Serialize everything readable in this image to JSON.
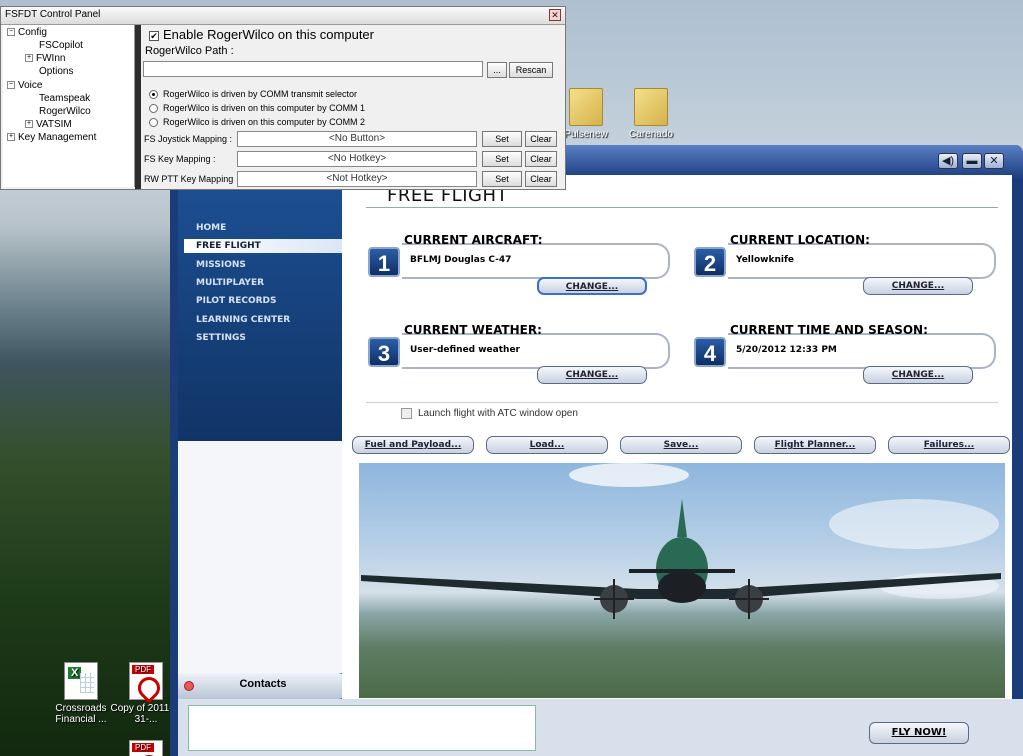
{
  "desktop": {
    "icons": [
      {
        "label": "Pulsenew",
        "type": "folder"
      },
      {
        "label": "Carenado",
        "type": "folder"
      },
      {
        "label": "Crossroads Financial ...",
        "type": "excel"
      },
      {
        "label": "Copy of 2011-7-31-...",
        "type": "pdf"
      }
    ]
  },
  "control_panel": {
    "title": "FSFDT Control Panel",
    "close_glyph": "✕",
    "tree": {
      "config": "Config",
      "fscopilot": "FSCopilot",
      "fwinn": "FWInn",
      "options": "Options",
      "voice": "Voice",
      "teamspeak": "Teamspeak",
      "rogerwilco": "RogerWilco",
      "vatsim": "VATSIM",
      "key_management": "Key Management"
    },
    "enable_label": "Enable RogerWilco on this computer",
    "enable_checked": true,
    "path_label": "RogerWilco Path :",
    "path_value": "",
    "browse_label": "...",
    "rescan_label": "Rescan",
    "radios": [
      {
        "label": "RogerWilco is driven by COMM transmit selector",
        "selected": true
      },
      {
        "label": "RogerWilco is driven on this computer by COMM 1",
        "selected": false
      },
      {
        "label": "RogerWilco is driven on this computer by COMM 2",
        "selected": false
      }
    ],
    "mappings": [
      {
        "label": "FS Joystick Mapping :",
        "value": "<No Button>",
        "set": "Set",
        "clear": "Clear"
      },
      {
        "label": "FS Key Mapping :",
        "value": "<No Hotkey>",
        "set": "Set",
        "clear": "Clear"
      },
      {
        "label": "RW PTT Key Mapping",
        "value": "<Not Hotkey>",
        "set": "Set",
        "clear": "Clear"
      }
    ]
  },
  "fsx": {
    "window_buttons": {
      "minimize": "▬",
      "close": "✕",
      "sound": "◀)"
    },
    "nav": {
      "home": "HOME",
      "free_flight": "FREE FLIGHT",
      "missions": "MISSIONS",
      "multiplayer": "MULTIPLAYER",
      "pilot_records": "PILOT RECORDS",
      "learning_center": "LEARNING CENTER",
      "settings": "SETTINGS"
    },
    "page_title": "FREE FLIGHT",
    "cards": [
      {
        "num": "1",
        "label": "CURRENT AIRCRAFT:",
        "value": "BFLMJ Douglas C-47",
        "button": "CHANGE..."
      },
      {
        "num": "2",
        "label": "CURRENT LOCATION:",
        "value": "Yellowknife",
        "button": "CHANGE..."
      },
      {
        "num": "3",
        "label": "CURRENT WEATHER:",
        "value": "User-defined weather",
        "button": "CHANGE..."
      },
      {
        "num": "4",
        "label": "CURRENT TIME AND SEASON:",
        "value": "5/20/2012 12:33 PM",
        "button": "CHANGE..."
      }
    ],
    "atc_label": "Launch flight with ATC window open",
    "atc_checked": false,
    "actions": {
      "fuel": "Fuel and Payload...",
      "load": "Load...",
      "save": "Save...",
      "planner": "Flight Planner...",
      "failures": "Failures..."
    },
    "contacts": "Contacts",
    "fly_now": "FLY NOW!"
  }
}
